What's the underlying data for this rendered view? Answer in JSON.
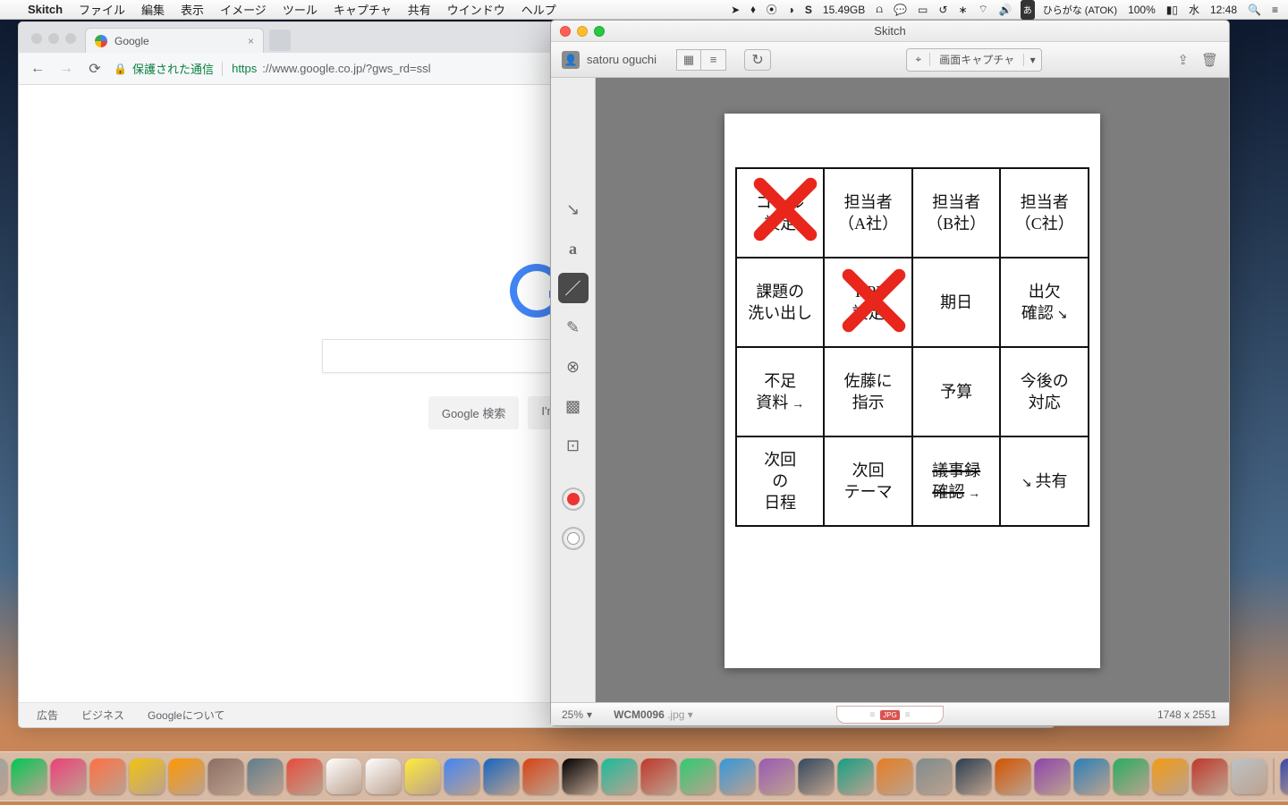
{
  "menubar": {
    "app_name": "Skitch",
    "items": [
      "ファイル",
      "編集",
      "表示",
      "イメージ",
      "ツール",
      "キャプチャ",
      "共有",
      "ウインドウ",
      "ヘルプ"
    ],
    "disk_free": "15.49GB",
    "ime": "あ",
    "ime_label": "ひらがな (ATOK)",
    "battery": "100%",
    "day": "水",
    "clock": "12:48"
  },
  "chrome": {
    "tab_title": "Google",
    "secure_label": "保護された通信",
    "url_scheme": "https",
    "url_rest": "://www.google.co.jp/?gws_rd=ssl",
    "btn_search": "Google 検索",
    "btn_lucky": "I'm Feeling Lucky",
    "footer": {
      "ads": "広告",
      "business": "ビジネス",
      "about": "Googleについて"
    }
  },
  "skitch": {
    "title": "Skitch",
    "user": "satoru oguchi",
    "capture_label": "画面キャプチャ",
    "tools": [
      "arrow",
      "text",
      "line",
      "marker",
      "stamp",
      "pixelate",
      "crop"
    ],
    "selected_tool": "line",
    "zoom": "25%",
    "filename": "WCM0096",
    "ext": ".jpg",
    "dims": "1748 x 2551",
    "drag_badge": "JPG"
  },
  "table": {
    "rows": [
      [
        "ゴール\n設定",
        "担当者\n（A社）",
        "担当者\n（B社）",
        "担当者\n（C社）"
      ],
      [
        "課題の\n洗い出し",
        "KPI\n設定",
        "期日",
        "出欠\n確認"
      ],
      [
        "不足\n資料",
        "佐藤に\n指示",
        "予算",
        "今後の\n対応"
      ],
      [
        "次回\nの\n日程",
        "次回\nテーマ",
        "議事録\n確認",
        "共有"
      ]
    ],
    "crossed_cells": [
      "0-0",
      "1-1"
    ],
    "struck_cells": [
      "3-2"
    ]
  },
  "dock_colors": [
    "#3b8ee6",
    "#6e6e6e",
    "#d35400",
    "#2e86de",
    "#8e44ad",
    "#6e6e6e",
    "#27ae60",
    "#95a5a6",
    "#00c853",
    "#ec407a",
    "#ff7043",
    "#f1c40f",
    "#ff9800",
    "#8d6e63",
    "#607d8b",
    "#e74c3c",
    "#ffffff",
    "#ffffff",
    "#ffeb3b",
    "#4285f4",
    "#1565c0",
    "#d84315",
    "#000000",
    "#1abc9c",
    "#c0392b",
    "#2ecc71",
    "#3498db",
    "#9b59b6",
    "#34495e",
    "#16a085",
    "#e67e22",
    "#7f8c8d",
    "#2c3e50",
    "#d35400",
    "#8e44ad",
    "#2980b9",
    "#27ae60",
    "#f39c12",
    "#c0392b",
    "#bdc3c7",
    "#3949ab",
    "#00acc1",
    "#43a047",
    "#fb8c00",
    "#6d4c41",
    "#5e35b1",
    "#00897b",
    "#546e7a"
  ]
}
